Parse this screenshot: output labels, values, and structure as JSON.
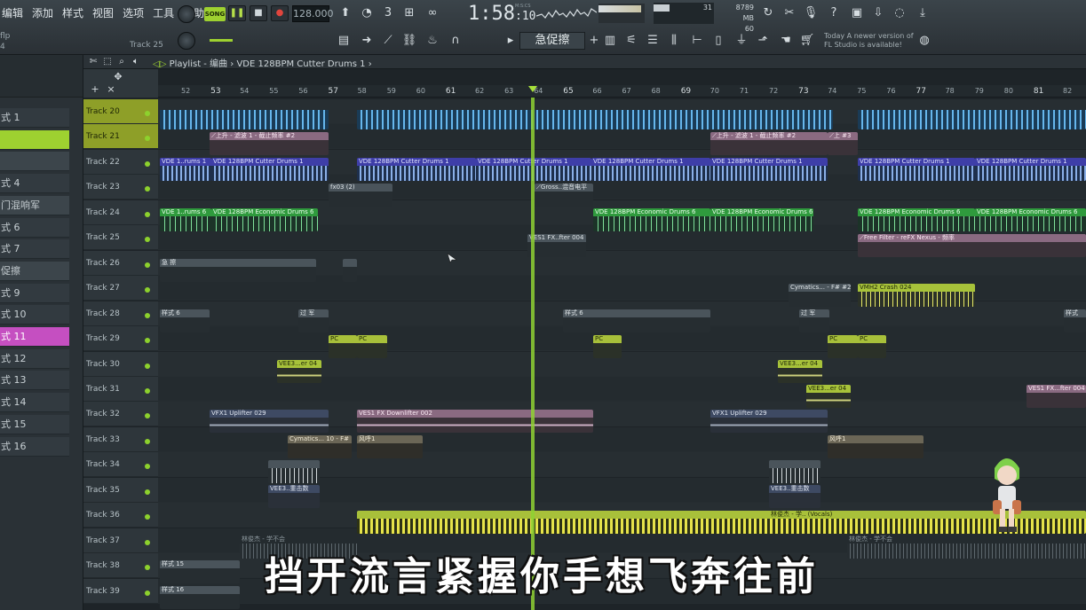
{
  "menu": [
    "编辑",
    "添加",
    "样式",
    "视图",
    "选项",
    "工具",
    "帮助"
  ],
  "file": {
    "name": "flp",
    "sub": "4",
    "track_label": "Track 25"
  },
  "transport": {
    "mode": "SONG",
    "tempo": "128.000",
    "time_main": "1:58",
    "time_sub": "10",
    "time_unit": "M:S:CS"
  },
  "system": {
    "cpu": "31",
    "memory": "8789 MB",
    "poly": "60"
  },
  "pattern_selector": "急促擦",
  "news": {
    "line1": "Today  A newer version of",
    "line2": "FL Studio is available!"
  },
  "playlist": {
    "title": "Playlist - 编曲",
    "clip": "VDE 128BPM Cutter Drums 1"
  },
  "ruler": [
    "52",
    "53",
    "54",
    "55",
    "56",
    "57",
    "58",
    "59",
    "60",
    "61",
    "62",
    "63",
    "64",
    "65",
    "66",
    "67",
    "68",
    "69",
    "70",
    "71",
    "72",
    "73",
    "74",
    "75",
    "76",
    "77",
    "78",
    "79",
    "80",
    "81",
    "82"
  ],
  "left_panel": [
    {
      "label": "式 1",
      "style": "normal"
    },
    {
      "label": "",
      "style": "green"
    },
    {
      "label": "",
      "style": "dark"
    },
    {
      "label": "式 4",
      "style": "normal"
    },
    {
      "label": "门混响军",
      "style": "dark"
    },
    {
      "label": "式 6",
      "style": "normal"
    },
    {
      "label": "式 7",
      "style": "normal"
    },
    {
      "label": "促擦",
      "style": "dark"
    },
    {
      "label": "式 9",
      "style": "normal"
    },
    {
      "label": "式 10",
      "style": "normal"
    },
    {
      "label": "式 11",
      "style": "pink"
    },
    {
      "label": "式 12",
      "style": "normal"
    },
    {
      "label": "式 13",
      "style": "normal"
    },
    {
      "label": "式 14",
      "style": "normal"
    },
    {
      "label": "式 15",
      "style": "normal"
    },
    {
      "label": "式 16",
      "style": "normal"
    }
  ],
  "tracks": [
    "Track 20",
    "Track 21",
    "Track 22",
    "Track 23",
    "Track 24",
    "Track 25",
    "Track 26",
    "Track 27",
    "Track 28",
    "Track 29",
    "Track 30",
    "Track 31",
    "Track 32",
    "Track 33",
    "Track 34",
    "Track 35",
    "Track 36",
    "Track 37",
    "Track 38",
    "Track 39"
  ],
  "clips": {
    "t21a": "⟋上升 - 滤波 1 - 截止频率 #2",
    "t21b": "⟋上升 - 滤波 1 - 截止频率 #2",
    "t21c": "⟋上 #3",
    "t22a": "VDE 1..rums 1",
    "t22b": "VDE 128BPM Cutter Drums 1",
    "t22c": "VDE 128BPM Cutter Drums 1",
    "t22d": "VDE 128BPM Cutter Drums 1",
    "t22e": "VDE 128BPM Cutter Drums 1",
    "t22f": "VDE 128BPM Cutter Drums 1",
    "t22g": "VDE 128BPM Cutter Drums 1",
    "t22h": "VDE 128BPM Cutter Drums 1",
    "t23a": "fx03 (2)",
    "t23b": "⟋Gross..混音电平",
    "t24a": "VDE 1..rums 6",
    "t24b": "VDE 128BPM Economic Drums 6",
    "t24c": "VDE 128BPM Economic Drums 6",
    "t24d": "VDE 128BPM Economic Drums 6",
    "t24e": "VDE 128BPM Economic Drums 6",
    "t24f": "VDE 128BPM Economic Drums 6",
    "t25a": "VES1 FX..fter 004",
    "t25b": "⟋Free Filter - reFX Nexus - 频率",
    "t26a": "急 擦",
    "t27a": "Cymatics... - F# #2",
    "t27b": "VMH2 Crash 024",
    "t28a": "样式 6",
    "t28b": "过 军",
    "t28c": "样式 6",
    "t28d": "过 军",
    "t28e": "样式",
    "t29a": "PC",
    "t29b": "PC",
    "t29c": "PC",
    "t29d": "PC",
    "t29e": "PC",
    "t30a": "VEE3...er 04",
    "t30b": "VEE3...er 04",
    "t31a": "VEE3...er 04",
    "t31b": "VES1 FX...fter 004",
    "t32a": "VFX1 Uplifter 029",
    "t32b": "VES1 FX Downlifter 002",
    "t32c": "VFX1 Uplifter 029",
    "t33a": "Cymatics... 10 - F#",
    "t33b": "风呼1",
    "t33c": "风呼1",
    "t35a": "VEE3..重击数",
    "t35b": "VEE3..重击数",
    "t36a": "林俊杰 - 学.. (Vocals)",
    "t37a": "林俊杰 - 学不会",
    "t37b": "林俊杰 - 学不会",
    "t38a": "样式 15",
    "t39a": "样式 16"
  },
  "subtitle": "挡开流言紧握你手想飞奔往前"
}
